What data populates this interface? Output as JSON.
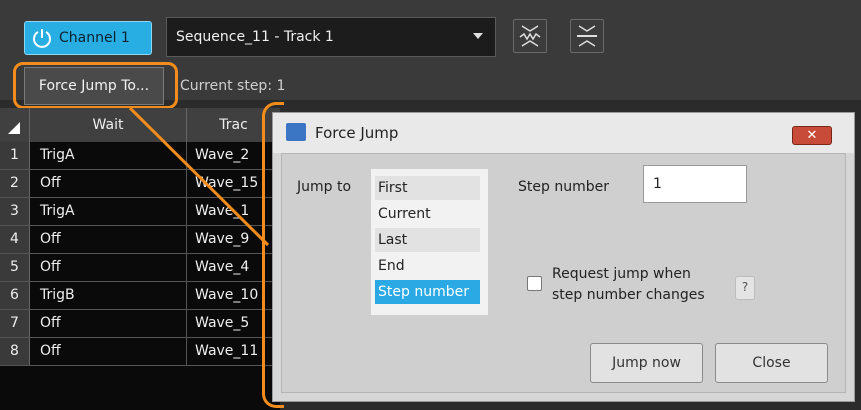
{
  "toolbar": {
    "channel_label": "Channel 1",
    "sequence_value": "Sequence_11 - Track 1",
    "force_jump_label": "Force Jump To...",
    "current_step_label": "Current step: 1"
  },
  "table": {
    "headers": [
      "Wait",
      "Trac"
    ],
    "rows": [
      {
        "num": "1",
        "wait": "TrigA",
        "track": "Wave_2"
      },
      {
        "num": "2",
        "wait": "Off",
        "track": "Wave_15"
      },
      {
        "num": "3",
        "wait": "TrigA",
        "track": "Wave_1"
      },
      {
        "num": "4",
        "wait": "Off",
        "track": "Wave_9"
      },
      {
        "num": "5",
        "wait": "Off",
        "track": "Wave_4"
      },
      {
        "num": "6",
        "wait": "TrigB",
        "track": "Wave_10"
      },
      {
        "num": "7",
        "wait": "Off",
        "track": "Wave_5"
      },
      {
        "num": "8",
        "wait": "Off",
        "track": "Wave_11"
      }
    ]
  },
  "dialog": {
    "title": "Force Jump",
    "close_glyph": "✕",
    "jump_to_label": "Jump to",
    "options": [
      "First",
      "Current",
      "Last",
      "End",
      "Step number"
    ],
    "selected_option": "Step number",
    "step_number_label": "Step number",
    "step_number_value": "1",
    "request_jump_label_line1": "Request jump when",
    "request_jump_label_line2": "step number changes",
    "help_glyph": "?",
    "jump_now_label": "Jump now",
    "close_label": "Close"
  },
  "colors": {
    "accent": "#29aee3",
    "callout": "#f28c1c",
    "selection": "#2aa9e5"
  },
  "icons": [
    "power-icon",
    "waveform-zoom-icon",
    "fit-icon",
    "dialog-app-icon",
    "close-icon",
    "sort-icon"
  ]
}
